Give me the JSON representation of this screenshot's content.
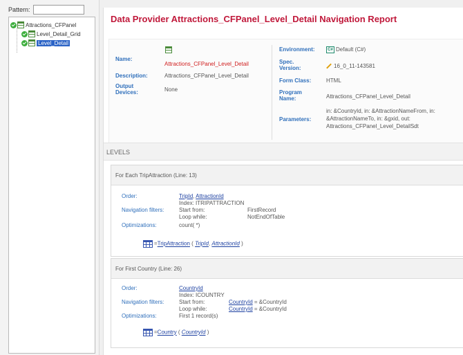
{
  "sidebar": {
    "pattern_label": "Pattern:",
    "pattern_value": "",
    "tree": [
      {
        "label": "Attractions_CFPanel"
      },
      {
        "label": "Level_Detail_Grid"
      },
      {
        "label": "Level_Detail"
      }
    ]
  },
  "report": {
    "title": "Data Provider Attractions_CFPanel_Level_Detail Navigation Report",
    "labels": {
      "name": "Name:",
      "description": "Description:",
      "output_devices": "Output Devices:",
      "environment": "Environment:",
      "spec_version": "Spec. Version:",
      "form_class": "Form Class:",
      "program_name": "Program Name:",
      "parameters": "Parameters:"
    },
    "name": "Attractions_CFPanel_Level_Detail",
    "description": "Attractions_CFPanel_Level_Detail",
    "output_devices": "None",
    "environment_badge": "C#",
    "environment": "Default (C#)",
    "spec_version": "16_0_11-143581",
    "form_class": "HTML",
    "program_name": "Attractions_CFPanel_Level_Detail",
    "parameters": [
      "in: &CountryId, in: &AttractionNameFrom, in:",
      "&AttractionNameTo, in: &gxid, out:",
      "Attractions_CFPanel_Level_DetailSdt"
    ]
  },
  "levels_title": "LEVELS",
  "sections": [
    {
      "header": "For Each TripAttraction (Line: 13)",
      "order_label": "Order:",
      "order_links": [
        "TripId",
        "AttractionId"
      ],
      "order_sep": ",",
      "index": "Index: ITRIPATTRACTION",
      "nav_label": "Navigation filters:",
      "start_label": "Start from:",
      "start_value": "FirstRecord",
      "loop_label": "Loop while:",
      "loop_value": "NotEndOfTable",
      "opt_label": "Optimizations:",
      "opt_value": "count( *)",
      "table_name": "TripAttraction",
      "table_keys": [
        "TripId",
        "AttractionId"
      ]
    },
    {
      "header": "For First Country (Line: 26)",
      "order_label": "Order:",
      "order_links": [
        "CountryId"
      ],
      "index": "Index: ICOUNTRY",
      "nav_label": "Navigation filters:",
      "start_label": "Start from:",
      "start_link": "CountryId",
      "start_value": " = &CountryId",
      "loop_label": "Loop while:",
      "loop_link": "CountryId",
      "loop_value": " = &CountryId",
      "opt_label": "Optimizations:",
      "opt_value": "First 1 record(s)",
      "table_name": "Country",
      "table_keys": [
        "CountryId"
      ]
    }
  ],
  "colors": {
    "title": "#c0183a",
    "label": "#2f6fbb",
    "link": "#1b3fa0"
  }
}
